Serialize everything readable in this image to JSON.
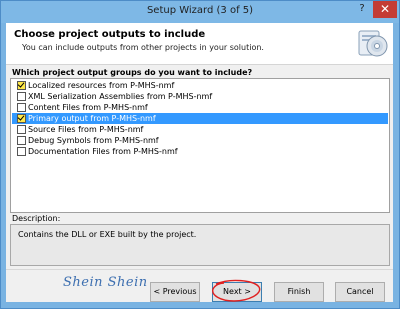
{
  "window": {
    "title": "Setup Wizard (3 of 5)",
    "help_glyph": "?",
    "close_glyph": "✕"
  },
  "header": {
    "title": "Choose project outputs to include",
    "subtitle": "You can include outputs from other projects in your solution."
  },
  "outputs": {
    "label": "Which project output groups do you want to include?",
    "items": [
      {
        "label": "Localized resources from P-MHS-nmf",
        "checked": true,
        "selected": false
      },
      {
        "label": "XML Serialization Assemblies from P-MHS-nmf",
        "checked": false,
        "selected": false
      },
      {
        "label": "Content Files from P-MHS-nmf",
        "checked": false,
        "selected": false
      },
      {
        "label": "Primary output from P-MHS-nmf",
        "checked": true,
        "selected": true
      },
      {
        "label": "Source Files from P-MHS-nmf",
        "checked": false,
        "selected": false
      },
      {
        "label": "Debug Symbols from P-MHS-nmf",
        "checked": false,
        "selected": false
      },
      {
        "label": "Documentation Files from P-MHS-nmf",
        "checked": false,
        "selected": false
      }
    ]
  },
  "description": {
    "label": "Description:",
    "text": "Contains the DLL or EXE built by the project."
  },
  "watermark": "Shein Shein",
  "buttons": {
    "previous": "< Previous",
    "next": "Next >",
    "finish": "Finish",
    "cancel": "Cancel"
  },
  "colors": {
    "titlebar": "#7eb8e6",
    "selection": "#3399ff",
    "checkbox_checked": "#ffe84a",
    "annotation": "#e02020"
  }
}
